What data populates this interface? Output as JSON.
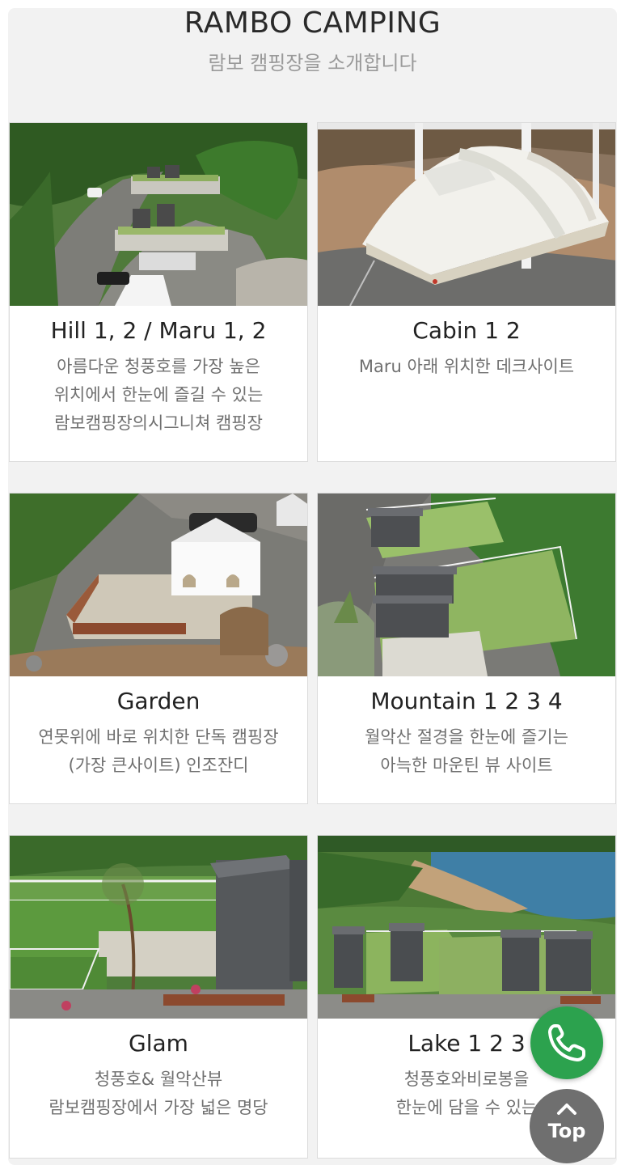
{
  "header": {
    "title": "RAMBO CAMPING",
    "subtitle": "람보 캠핑장을 소개합니다"
  },
  "sites": [
    {
      "name": "Hill 1, 2 / Maru 1, 2",
      "desc": [
        "아름다운 청풍호를 가장 높은",
        "위치에서 한눈에 즐길 수 있는",
        "람보캠핑장의시그니쳐 캠핑장"
      ]
    },
    {
      "name": "Cabin 1 2",
      "desc": [
        "Maru 아래 위치한 데크사이트"
      ]
    },
    {
      "name": "Garden",
      "desc": [
        "연못위에 바로 위치한 단독 캠핑장",
        "(가장 큰사이트) 인조잔디"
      ]
    },
    {
      "name": "Mountain 1 2 3 4",
      "desc": [
        "월악산 절경을 한눈에 즐기는",
        "아늑한 마운틴 뷰 사이트"
      ]
    },
    {
      "name": "Glam",
      "desc": [
        "청풍호& 월악산뷰",
        "람보캠핑장에서 가장 넓은 명당"
      ]
    },
    {
      "name": "Lake 1 2 3",
      "desc": [
        "청풍호와비로봉을",
        "한눈에 담을 수 있는"
      ]
    }
  ],
  "fab": {
    "call_icon": "phone-icon",
    "top_label": "Top",
    "call_color": "#2ca24e",
    "top_color": "#6f6f6f"
  }
}
